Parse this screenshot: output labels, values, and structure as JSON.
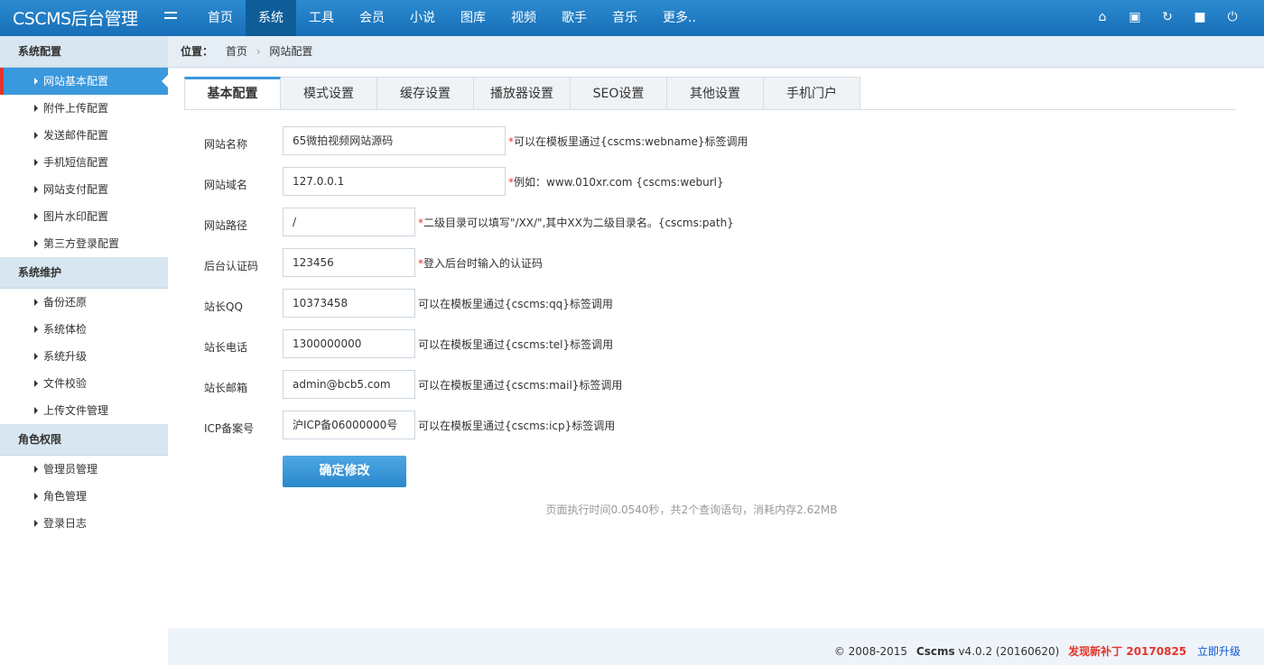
{
  "app": {
    "title": "CSCMS后台管理"
  },
  "nav": {
    "items": [
      "首页",
      "系统",
      "工具",
      "会员",
      "小说",
      "图库",
      "视频",
      "歌手",
      "音乐",
      "更多.."
    ],
    "active": "系统"
  },
  "top_icons": [
    "home-icon",
    "monitor-icon",
    "refresh-icon",
    "save-icon",
    "power-icon"
  ],
  "sidebar": {
    "groups": [
      {
        "title": "系统配置",
        "items": [
          "网站基本配置",
          "附件上传配置",
          "发送邮件配置",
          "手机短信配置",
          "网站支付配置",
          "图片水印配置",
          "第三方登录配置"
        ]
      },
      {
        "title": "系统维护",
        "items": [
          "备份还原",
          "系统体检",
          "系统升级",
          "文件校验",
          "上传文件管理"
        ]
      },
      {
        "title": "角色权限",
        "items": [
          "管理员管理",
          "角色管理",
          "登录日志"
        ]
      }
    ],
    "active_item": "网站基本配置"
  },
  "breadcrumb": {
    "label": "位置：",
    "items": [
      "首页",
      "网站配置"
    ]
  },
  "tabs": [
    "基本配置",
    "模式设置",
    "缓存设置",
    "播放器设置",
    "SEO设置",
    "其他设置",
    "手机门户"
  ],
  "active_tab": "基本配置",
  "form": {
    "fields": [
      {
        "label": "网站名称",
        "value": "65微拍视频网站源码",
        "hint": "可以在模板里通过{cscms:webname}标签调用",
        "required": true
      },
      {
        "label": "网站域名",
        "value": "127.0.0.1",
        "hint": "例如：www.010xr.com {cscms:weburl}",
        "required": true
      },
      {
        "label": "网站路径",
        "value": "/",
        "hint": "二级目录可以填写\"/XX/\",其中XX为二级目录名。{cscms:path}",
        "required": true
      },
      {
        "label": "后台认证码",
        "value": "123456",
        "hint": "登入后台时输入的认证码",
        "required": true
      },
      {
        "label": "站长QQ",
        "value": "10373458",
        "hint": "可以在模板里通过{cscms:qq}标签调用",
        "required": false
      },
      {
        "label": "站长电话",
        "value": "1300000000",
        "hint": "可以在模板里通过{cscms:tel}标签调用",
        "required": false
      },
      {
        "label": "站长邮箱",
        "value": "admin@bcb5.com",
        "hint": "可以在模板里通过{cscms:mail}标签调用",
        "required": false
      },
      {
        "label": "ICP备案号",
        "value": "沪ICP备06000000号",
        "hint": "可以在模板里通过{cscms:icp}标签调用",
        "required": false
      }
    ],
    "submit_label": "确定修改"
  },
  "exec_info": "页面执行时间0.0540秒，共2个查询语句，消耗内存2.62MB",
  "footer": {
    "copyright": "© 2008-2015",
    "brand": "Cscms",
    "version": "v4.0.2 (20160620)",
    "patch": "发现新补丁 20170825",
    "upgrade": "立即升级"
  },
  "colors": {
    "topbar": "#1f7dc3",
    "accent": "#3a98dd",
    "required": "#e4342b"
  }
}
